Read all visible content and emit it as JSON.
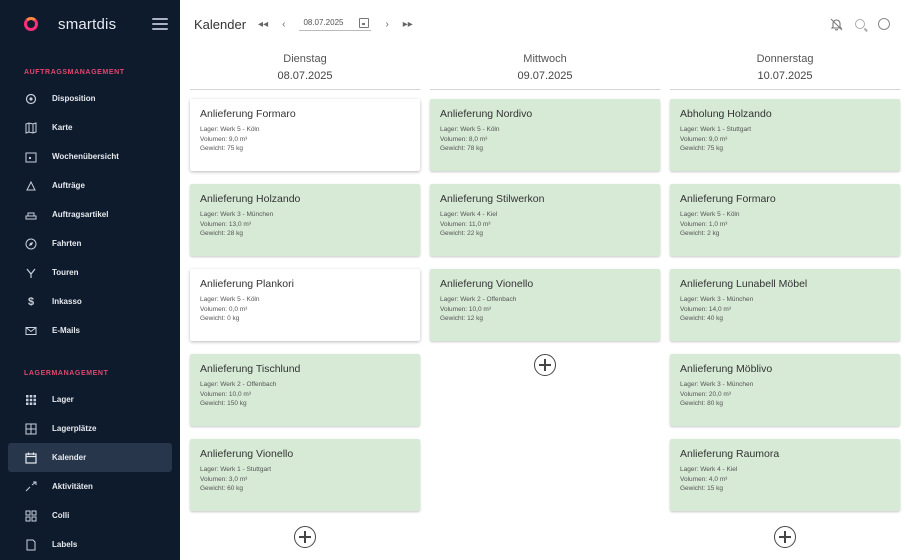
{
  "sidebar": {
    "brand": "smartdis",
    "sections": [
      {
        "title": "AUFTRAGSMANAGEMENT",
        "items": [
          {
            "label": "Disposition",
            "icon": "gear-icon"
          },
          {
            "label": "Karte",
            "icon": "map-icon"
          },
          {
            "label": "Wochenübersicht",
            "icon": "calendar-week-icon"
          },
          {
            "label": "Aufträge",
            "icon": "orders-icon"
          },
          {
            "label": "Auftragsartikel",
            "icon": "articles-icon"
          },
          {
            "label": "Fahrten",
            "icon": "compass-icon"
          },
          {
            "label": "Touren",
            "icon": "route-icon"
          },
          {
            "label": "Inkasso",
            "icon": "dollar-icon"
          },
          {
            "label": "E-Mails",
            "icon": "mail-icon"
          }
        ]
      },
      {
        "title": "LAGERMANAGEMENT",
        "items": [
          {
            "label": "Lager",
            "icon": "warehouse-icon"
          },
          {
            "label": "Lagerplätze",
            "icon": "storage-icon"
          },
          {
            "label": "Kalender",
            "icon": "calendar-icon",
            "active": true
          },
          {
            "label": "Aktivitäten",
            "icon": "activity-icon"
          },
          {
            "label": "Colli",
            "icon": "box-icon"
          },
          {
            "label": "Labels",
            "icon": "label-icon"
          }
        ]
      }
    ]
  },
  "topbar": {
    "title": "Kalender",
    "first": "◂◂",
    "prev": "‹",
    "date": "08.07.2025",
    "next": "›",
    "last": "▸▸"
  },
  "days": [
    {
      "name": "Dienstag",
      "date": "08.07.2025",
      "cards": [
        {
          "title": "Anlieferung Formaro",
          "lager": "Lager: Werk 5 - Köln",
          "volumen": "Volumen: 9,0 m³",
          "gewicht": "Gewicht: 75 kg",
          "style": "white"
        },
        {
          "title": "Anlieferung Holzando",
          "lager": "Lager: Werk 3 - München",
          "volumen": "Volumen: 13,0 m³",
          "gewicht": "Gewicht: 28 kg",
          "style": "green"
        },
        {
          "title": "Anlieferung Plankori",
          "lager": "Lager: Werk 5 - Köln",
          "volumen": "Volumen: 0,0 m³",
          "gewicht": "Gewicht: 0 kg",
          "style": "white"
        },
        {
          "title": "Anlieferung Tischlund",
          "lager": "Lager: Werk 2 - Offenbach",
          "volumen": "Volumen: 10,0 m³",
          "gewicht": "Gewicht: 150 kg",
          "style": "green"
        },
        {
          "title": "Anlieferung Vionello",
          "lager": "Lager: Werk 1 - Stuttgart",
          "volumen": "Volumen: 3,0 m³",
          "gewicht": "Gewicht: 60 kg",
          "style": "green"
        }
      ]
    },
    {
      "name": "Mittwoch",
      "date": "09.07.2025",
      "cards": [
        {
          "title": "Anlieferung Nordivo",
          "lager": "Lager: Werk 5 - Köln",
          "volumen": "Volumen: 8,0 m³",
          "gewicht": "Gewicht: 78 kg",
          "style": "green"
        },
        {
          "title": "Anlieferung Stilwerkon",
          "lager": "Lager: Werk 4 - Kiel",
          "volumen": "Volumen: 11,0 m³",
          "gewicht": "Gewicht: 22 kg",
          "style": "green"
        },
        {
          "title": "Anlieferung Vionello",
          "lager": "Lager: Werk 2 - Offenbach",
          "volumen": "Volumen: 10,0 m³",
          "gewicht": "Gewicht: 12 kg",
          "style": "green"
        }
      ]
    },
    {
      "name": "Donnerstag",
      "date": "10.07.2025",
      "cards": [
        {
          "title": "Abholung Holzando",
          "lager": "Lager: Werk 1 - Stuttgart",
          "volumen": "Volumen: 9,0 m³",
          "gewicht": "Gewicht: 75 kg",
          "style": "green"
        },
        {
          "title": "Anlieferung Formaro",
          "lager": "Lager: Werk 5 - Köln",
          "volumen": "Volumen: 1,0 m³",
          "gewicht": "Gewicht: 2 kg",
          "style": "green"
        },
        {
          "title": "Anlieferung Lunabell Möbel",
          "lager": "Lager: Werk 3 - München",
          "volumen": "Volumen: 14,0 m³",
          "gewicht": "Gewicht: 40 kg",
          "style": "green"
        },
        {
          "title": "Anlieferung Möblivo",
          "lager": "Lager: Werk 3 - München",
          "volumen": "Volumen: 20,0 m³",
          "gewicht": "Gewicht: 80 kg",
          "style": "green"
        },
        {
          "title": "Anlieferung Raumora",
          "lager": "Lager: Werk 4 - Kiel",
          "volumen": "Volumen: 4,0 m³",
          "gewicht": "Gewicht: 15 kg",
          "style": "green"
        }
      ]
    }
  ]
}
